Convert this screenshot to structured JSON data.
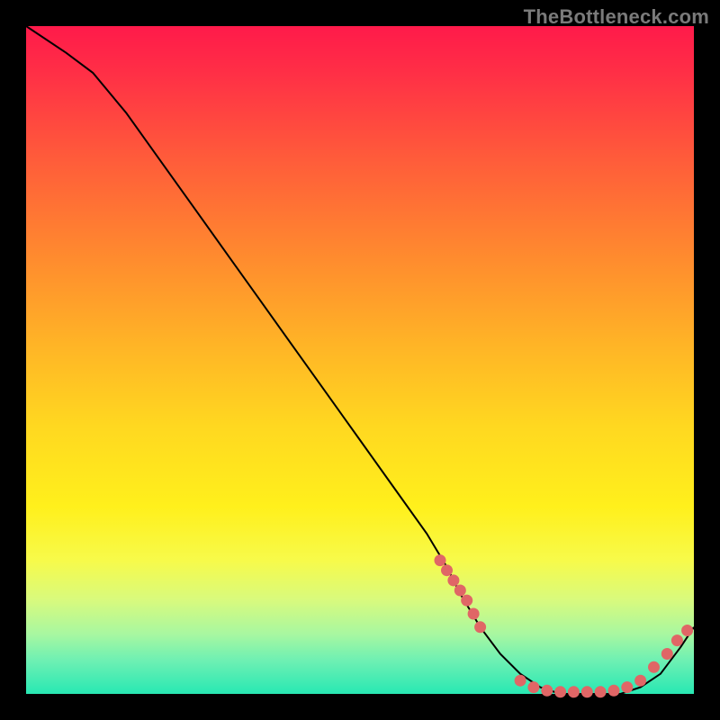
{
  "watermark": "TheBottleneck.com",
  "chart_data": {
    "type": "line",
    "title": "",
    "xlabel": "",
    "ylabel": "",
    "xlim": [
      0,
      100
    ],
    "ylim": [
      0,
      100
    ],
    "grid": false,
    "legend": false,
    "series": [
      {
        "name": "bottleneck-curve",
        "x": [
          0,
          6,
          10,
          15,
          20,
          25,
          30,
          35,
          40,
          45,
          50,
          55,
          60,
          63,
          65,
          68,
          71,
          74,
          77,
          80,
          83,
          86,
          89,
          92,
          95,
          98,
          100
        ],
        "values": [
          100,
          96,
          93,
          87,
          80,
          73,
          66,
          59,
          52,
          45,
          38,
          31,
          24,
          19,
          15,
          10,
          6,
          3,
          1,
          0,
          0,
          0,
          0,
          1,
          3,
          7,
          10
        ]
      }
    ],
    "markers": [
      {
        "name": "left-cluster",
        "x": [
          62,
          63,
          64,
          65,
          66,
          67,
          68
        ],
        "values": [
          20,
          18.5,
          17,
          15.5,
          14,
          12,
          10
        ]
      },
      {
        "name": "floor-cluster",
        "x": [
          74,
          76,
          78,
          80,
          82,
          84,
          86,
          88,
          90
        ],
        "values": [
          2,
          1,
          0.5,
          0.3,
          0.3,
          0.3,
          0.3,
          0.5,
          1
        ]
      },
      {
        "name": "rise-cluster",
        "x": [
          92,
          94,
          96,
          97.5,
          99
        ],
        "values": [
          2,
          4,
          6,
          8,
          9.5
        ]
      }
    ],
    "marker_color": "#e06666",
    "line_color": "#000000"
  }
}
